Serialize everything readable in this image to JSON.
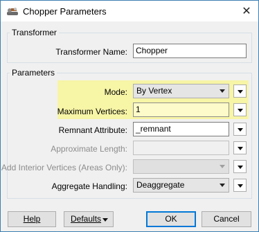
{
  "window": {
    "title": "Chopper Parameters"
  },
  "transformer_group": {
    "label": "Transformer",
    "name_label": "Transformer Name:",
    "name_value": "Chopper"
  },
  "parameters_group": {
    "label": "Parameters",
    "rows": {
      "mode": {
        "label": "Mode:",
        "value": "By Vertex"
      },
      "max_vertices": {
        "label": "Maximum Vertices:",
        "value": "1"
      },
      "remnant": {
        "label": "Remnant Attribute:",
        "value": "_remnant"
      },
      "approx_length": {
        "label": "Approximate Length:",
        "value": ""
      },
      "interior_vertices": {
        "label": "Add Interior Vertices (Areas Only):",
        "value": ""
      },
      "aggregate": {
        "label": "Aggregate Handling:",
        "value": "Deaggregate"
      }
    },
    "highlight_color": "#f7f5a6"
  },
  "buttons": {
    "help": "Help",
    "defaults": "Defaults",
    "ok": "OK",
    "cancel": "Cancel"
  },
  "icons": {
    "app": "fme-transformer-icon",
    "close": "close-icon"
  }
}
